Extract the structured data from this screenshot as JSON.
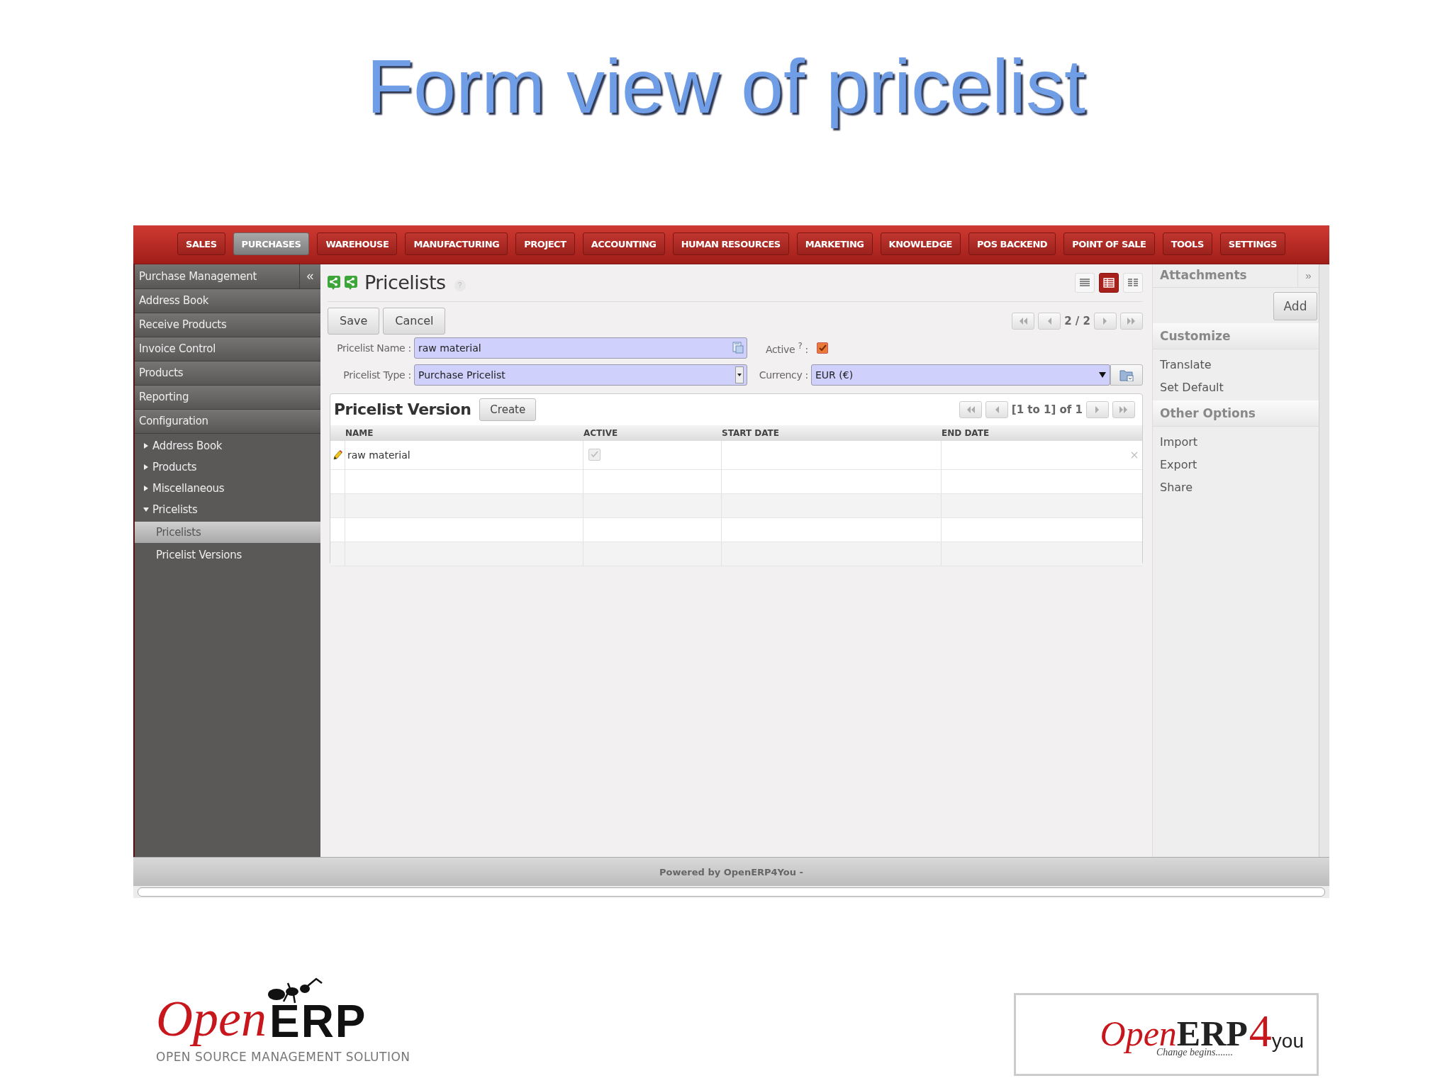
{
  "slide": {
    "title": "Form view of pricelist"
  },
  "menu": {
    "tabs": [
      {
        "label": "SALES",
        "selected": false
      },
      {
        "label": "PURCHASES",
        "selected": true
      },
      {
        "label": "WAREHOUSE",
        "selected": false
      },
      {
        "label": "MANUFACTURING",
        "selected": false
      },
      {
        "label": "PROJECT",
        "selected": false
      },
      {
        "label": "ACCOUNTING",
        "selected": false
      },
      {
        "label": "HUMAN RESOURCES",
        "selected": false
      },
      {
        "label": "MARKETING",
        "selected": false
      },
      {
        "label": "KNOWLEDGE",
        "selected": false
      },
      {
        "label": "POS BACKEND",
        "selected": false
      },
      {
        "label": "POINT OF SALE",
        "selected": false
      },
      {
        "label": "TOOLS",
        "selected": false
      },
      {
        "label": "SETTINGS",
        "selected": false
      }
    ]
  },
  "sidebar": {
    "heading": "Purchase Management",
    "collapse": "«",
    "sections": [
      "Address Book",
      "Receive Products",
      "Invoice Control",
      "Products",
      "Reporting",
      "Configuration"
    ],
    "tree": [
      {
        "label": "Address Book",
        "expanded": false
      },
      {
        "label": "Products",
        "expanded": false
      },
      {
        "label": "Miscellaneous",
        "expanded": false
      },
      {
        "label": "Pricelists",
        "expanded": true,
        "children": [
          {
            "label": "Pricelists",
            "selected": true
          },
          {
            "label": "Pricelist Versions",
            "selected": false
          }
        ]
      }
    ]
  },
  "form": {
    "title": "Pricelists",
    "help": "?",
    "views": [
      {
        "kind": "list",
        "selected": false
      },
      {
        "kind": "form",
        "selected": true
      },
      {
        "kind": "columns",
        "selected": false
      }
    ],
    "buttons": [
      "Save",
      "Cancel"
    ],
    "pager": "2 / 2",
    "name": {
      "label": "Pricelist Name :",
      "value": "raw material"
    },
    "active": {
      "label": "Active $^{?}$ :",
      "checked": true
    },
    "type": {
      "label": "Pricelist Type :",
      "value": "Purchase Pricelist"
    },
    "currency": {
      "label": "Currency :",
      "value": "EUR (€)"
    },
    "versions": {
      "title": "Pricelist Version",
      "create": "Create",
      "pager": "[1 to 1] of 1",
      "columns": [
        "NAME",
        "ACTIVE",
        "START DATE",
        "END DATE"
      ],
      "rows": [
        {
          "name": "raw material",
          "active": true
        }
      ]
    }
  },
  "panel": {
    "attachments": "Attachments",
    "expand": "»",
    "add": "Add",
    "sections": [
      {
        "title": "Customize",
        "items": [
          "Translate",
          "Set Default"
        ]
      },
      {
        "title": "Other Options",
        "items": [
          "Import",
          "Export",
          "Share"
        ]
      }
    ]
  },
  "footer": {
    "text": "Powered by OpenERP4You -"
  },
  "logos": {
    "left": {
      "open": "Open",
      "erp": "ERP",
      "tagline": "OPEN SOURCE MANAGEMENT SOLUTION"
    },
    "right": {
      "open": "Open",
      "erp": "ERP",
      "four": "4",
      "you": "you",
      "tagline": "Change begins......."
    }
  }
}
